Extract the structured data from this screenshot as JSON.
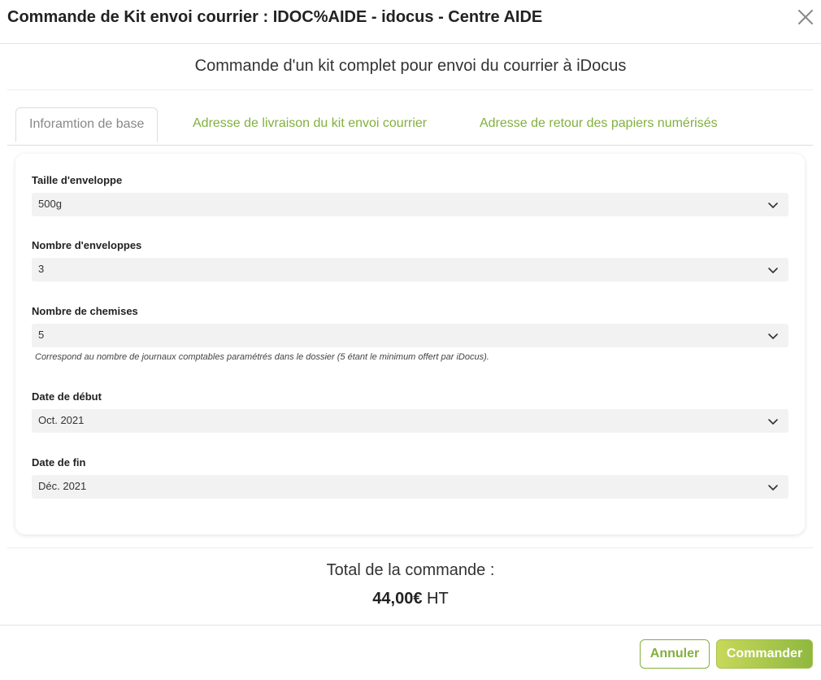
{
  "modal": {
    "title": "Commande de Kit envoi courrier : IDOC%AIDE - idocus - Centre AIDE",
    "subtitle": "Commande d'un kit complet pour envoi du courrier à iDocus"
  },
  "tabs": [
    {
      "label": "Inforamtion de base",
      "active": true
    },
    {
      "label": "Adresse de livraison du kit envoi courrier",
      "active": false
    },
    {
      "label": "Adresse de retour des papiers numérisés",
      "active": false
    }
  ],
  "form": {
    "envelope_size": {
      "label": "Taille d'enveloppe",
      "value": "500g"
    },
    "envelope_count": {
      "label": "Nombre d'enveloppes",
      "value": "3"
    },
    "folder_count": {
      "label": "Nombre de chemises",
      "value": "5",
      "help": "Correspond au nombre de journaux comptables paramétrés dans le dossier (5 étant le minimum offert par iDocus)."
    },
    "start_date": {
      "label": "Date de début",
      "value": "Oct. 2021"
    },
    "end_date": {
      "label": "Date de fin",
      "value": "Déc. 2021"
    }
  },
  "total": {
    "label": "Total de la commande :",
    "amount": "44,00€",
    "suffix": "HT"
  },
  "actions": {
    "cancel_label": "Annuler",
    "submit_label": "Commander"
  },
  "colors": {
    "accent": "#82b03f",
    "button_gradient_start": "#c8d85a",
    "button_gradient_end": "#8fb840"
  }
}
